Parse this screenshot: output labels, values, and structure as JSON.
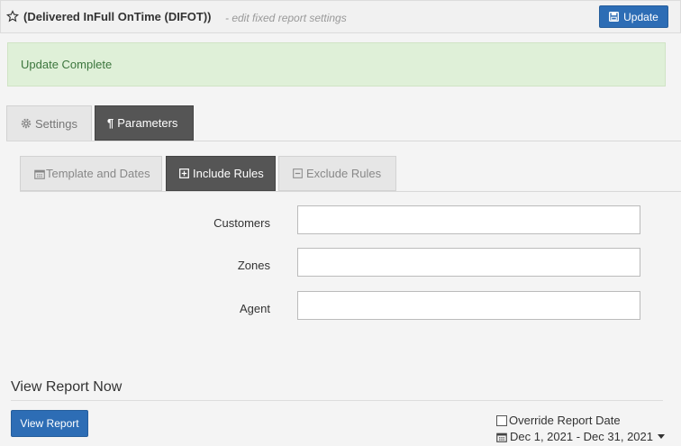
{
  "header": {
    "title": "(Delivered InFull OnTime (DIFOT))",
    "subtitle": "- edit fixed report settings",
    "update_label": "Update"
  },
  "alert": {
    "message": "Update Complete"
  },
  "tabs": [
    {
      "label": "Settings",
      "icon": "gear-icon",
      "active": false
    },
    {
      "label": "Parameters",
      "icon": "paragraph-icon",
      "active": true
    }
  ],
  "subtabs": [
    {
      "label": "Template and Dates",
      "icon": "calendar-icon",
      "active": false
    },
    {
      "label": "Include Rules",
      "icon": "plus-square-icon",
      "active": true
    },
    {
      "label": "Exclude Rules",
      "icon": "minus-square-icon",
      "active": false
    }
  ],
  "fields": {
    "customers": {
      "label": "Customers",
      "value": ""
    },
    "zones": {
      "label": "Zones",
      "value": ""
    },
    "agent": {
      "label": "Agent",
      "value": ""
    }
  },
  "view": {
    "title": "View Report Now",
    "button_label": "View Report",
    "override_label": "Override Report Date",
    "override_checked": false,
    "date_range": "Dec 1, 2021 - Dec 31, 2021"
  },
  "colors": {
    "primary": "#2d6db5",
    "alert_bg": "#dff0d8",
    "alert_text": "#3c763d",
    "active_tab": "#555555"
  }
}
